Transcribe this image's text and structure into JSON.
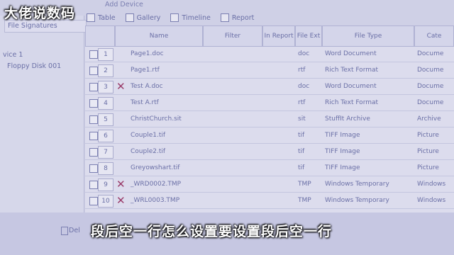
{
  "watermark": "大佬说数码",
  "caption": "段后空一行怎么设置要设置段后空一行",
  "toolbar": {
    "add_device": "Add Device"
  },
  "left_panel": {
    "tab_label": "File Signatures",
    "tree": [
      "vice 1",
      "Floppy Disk 001"
    ]
  },
  "view_options": [
    {
      "label": "Table"
    },
    {
      "label": "Gallery"
    },
    {
      "label": "Timeline"
    },
    {
      "label": "Report"
    }
  ],
  "columns": [
    "Name",
    "Filter",
    "In Report",
    "File Ext",
    "File Type",
    "Cate"
  ],
  "rows": [
    {
      "num": "1",
      "deleted": false,
      "name": "Page1.doc",
      "ext": "doc",
      "type": "Word Document",
      "cat": "Docume"
    },
    {
      "num": "2",
      "deleted": false,
      "name": "Page1.rtf",
      "ext": "rtf",
      "type": "Rich Text Format",
      "cat": "Docume"
    },
    {
      "num": "3",
      "deleted": true,
      "name": "Test A.doc",
      "ext": "doc",
      "type": "Word Document",
      "cat": "Docume"
    },
    {
      "num": "4",
      "deleted": false,
      "name": "Test A.rtf",
      "ext": "rtf",
      "type": "Rich Text Format",
      "cat": "Docume"
    },
    {
      "num": "5",
      "deleted": false,
      "name": "ChristChurch.sit",
      "ext": "sit",
      "type": "StuffIt Archive",
      "cat": "Archive"
    },
    {
      "num": "6",
      "deleted": false,
      "name": "Couple1.tif",
      "ext": "tif",
      "type": "TIFF Image",
      "cat": "Picture"
    },
    {
      "num": "7",
      "deleted": false,
      "name": "Couple2.tif",
      "ext": "tif",
      "type": "TIFF Image",
      "cat": "Picture"
    },
    {
      "num": "8",
      "deleted": false,
      "name": "Greyowshart.tif",
      "ext": "tif",
      "type": "TIFF Image",
      "cat": "Picture"
    },
    {
      "num": "9",
      "deleted": true,
      "name": "_WRD0002.TMP",
      "ext": "TMP",
      "type": "Windows Temporary",
      "cat": "Windows"
    },
    {
      "num": "10",
      "deleted": true,
      "name": "_WRL0003.TMP",
      "ext": "TMP",
      "type": "Windows Temporary",
      "cat": "Windows"
    }
  ],
  "footer": {
    "delete_label": "Del"
  },
  "colors": {
    "background": "#cfd0e6",
    "text": "#6a6fa6",
    "deleted_mark": "#9a3c6a"
  }
}
